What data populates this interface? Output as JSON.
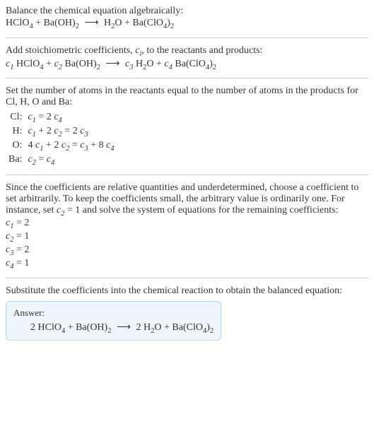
{
  "s1": {
    "title": "Balance the chemical equation algebraically:",
    "eq_html": "HClO<span class='sub'>4</span> + Ba(OH)<span class='sub'>2</span> <span class='arrow'>⟶</span> H<span class='sub'>2</span>O + Ba(ClO<span class='sub'>4</span>)<span class='sub'>2</span>"
  },
  "s2": {
    "title_html": "Add stoichiometric coefficients, <span class='italic'>c<span class='sub'>i</span></span>, to the reactants and products:",
    "eq_html": "<span class='italic'>c<span class='sub'>1</span></span> HClO<span class='sub'>4</span> + <span class='italic'>c<span class='sub'>2</span></span> Ba(OH)<span class='sub'>2</span> <span class='arrow'>⟶</span> <span class='italic'>c<span class='sub'>3</span></span> H<span class='sub'>2</span>O + <span class='italic'>c<span class='sub'>4</span></span> Ba(ClO<span class='sub'>4</span>)<span class='sub'>2</span>"
  },
  "s3": {
    "title": "Set the number of atoms in the reactants equal to the number of atoms in the products for Cl, H, O and Ba:",
    "rows": [
      {
        "label": "Cl:",
        "value_html": "<span class='italic'>c<span class='sub'>1</span></span> = 2 <span class='italic'>c<span class='sub'>4</span></span>"
      },
      {
        "label": "H:",
        "value_html": "<span class='italic'>c<span class='sub'>1</span></span> + 2 <span class='italic'>c<span class='sub'>2</span></span> = 2 <span class='italic'>c<span class='sub'>3</span></span>"
      },
      {
        "label": "O:",
        "value_html": "4 <span class='italic'>c<span class='sub'>1</span></span> + 2 <span class='italic'>c<span class='sub'>2</span></span> = <span class='italic'>c<span class='sub'>3</span></span> + 8 <span class='italic'>c<span class='sub'>4</span></span>"
      },
      {
        "label": "Ba:",
        "value_html": "<span class='italic'>c<span class='sub'>2</span></span> = <span class='italic'>c<span class='sub'>4</span></span>"
      }
    ]
  },
  "s4": {
    "title_html": "Since the coefficients are relative quantities and underdetermined, choose a coefficient to set arbitrarily. To keep the coefficients small, the arbitrary value is ordinarily one. For instance, set <span class='italic'>c<span class='sub'>2</span></span> = 1 and solve the system of equations for the remaining coefficients:",
    "lines_html": [
      "<span class='italic'>c<span class='sub'>1</span></span> = 2",
      "<span class='italic'>c<span class='sub'>2</span></span> = 1",
      "<span class='italic'>c<span class='sub'>3</span></span> = 2",
      "<span class='italic'>c<span class='sub'>4</span></span> = 1"
    ]
  },
  "s5": {
    "title": "Substitute the coefficients into the chemical reaction to obtain the balanced equation:",
    "answer_label": "Answer:",
    "answer_html": "2 HClO<span class='sub'>4</span> + Ba(OH)<span class='sub'>2</span> <span class='arrow'>⟶</span> 2 H<span class='sub'>2</span>O + Ba(ClO<span class='sub'>4</span>)<span class='sub'>2</span>"
  }
}
